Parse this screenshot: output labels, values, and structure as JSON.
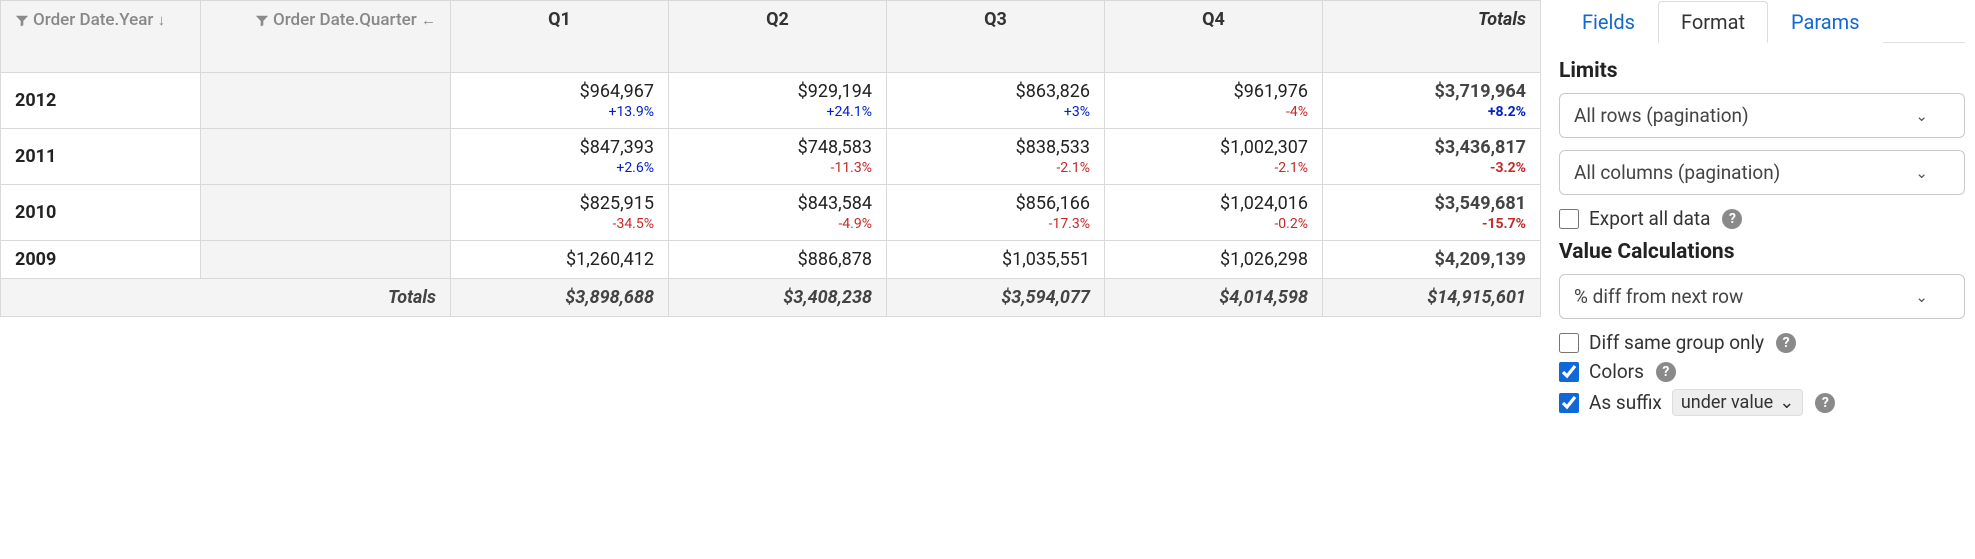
{
  "pivot": {
    "row_header": {
      "label": "Order Date.Year",
      "sort_indicator": "↓"
    },
    "col_header": {
      "label": "Order Date.Quarter",
      "sort_indicator": "←"
    },
    "columns": [
      "Q1",
      "Q2",
      "Q3",
      "Q4"
    ],
    "totals_label": "Totals",
    "rows": [
      {
        "year": "2012",
        "cells": [
          {
            "value": "$964,967",
            "pct": "+13.9%",
            "dir": "pos"
          },
          {
            "value": "$929,194",
            "pct": "+24.1%",
            "dir": "pos"
          },
          {
            "value": "$863,826",
            "pct": "+3%",
            "dir": "pos"
          },
          {
            "value": "$961,976",
            "pct": "-4%",
            "dir": "neg"
          }
        ],
        "total": {
          "value": "$3,719,964",
          "pct": "+8.2%",
          "dir": "pos"
        }
      },
      {
        "year": "2011",
        "cells": [
          {
            "value": "$847,393",
            "pct": "+2.6%",
            "dir": "pos"
          },
          {
            "value": "$748,583",
            "pct": "-11.3%",
            "dir": "neg"
          },
          {
            "value": "$838,533",
            "pct": "-2.1%",
            "dir": "neg"
          },
          {
            "value": "$1,002,307",
            "pct": "-2.1%",
            "dir": "neg"
          }
        ],
        "total": {
          "value": "$3,436,817",
          "pct": "-3.2%",
          "dir": "neg"
        }
      },
      {
        "year": "2010",
        "cells": [
          {
            "value": "$825,915",
            "pct": "-34.5%",
            "dir": "neg"
          },
          {
            "value": "$843,584",
            "pct": "-4.9%",
            "dir": "neg"
          },
          {
            "value": "$856,166",
            "pct": "-17.3%",
            "dir": "neg"
          },
          {
            "value": "$1,024,016",
            "pct": "-0.2%",
            "dir": "neg"
          }
        ],
        "total": {
          "value": "$3,549,681",
          "pct": "-15.7%",
          "dir": "neg"
        }
      },
      {
        "year": "2009",
        "cells": [
          {
            "value": "$1,260,412",
            "pct": "",
            "dir": ""
          },
          {
            "value": "$886,878",
            "pct": "",
            "dir": ""
          },
          {
            "value": "$1,035,551",
            "pct": "",
            "dir": ""
          },
          {
            "value": "$1,026,298",
            "pct": "",
            "dir": ""
          }
        ],
        "total": {
          "value": "$4,209,139",
          "pct": "",
          "dir": ""
        }
      }
    ],
    "grand_totals": [
      "$3,898,688",
      "$3,408,238",
      "$3,594,077",
      "$4,014,598",
      "$14,915,601"
    ]
  },
  "sidepanel": {
    "tabs": {
      "fields": "Fields",
      "format": "Format",
      "params": "Params",
      "active": "format"
    },
    "limits": {
      "title": "Limits",
      "rows_select": "All rows (pagination)",
      "cols_select": "All columns (pagination)",
      "export_label": "Export all data",
      "export_checked": false
    },
    "valuecalc": {
      "title": "Value Calculations",
      "calc_select": "% diff from next row",
      "diff_same_group_label": "Diff same group only",
      "diff_same_group_checked": false,
      "colors_label": "Colors",
      "colors_checked": true,
      "suffix_label": "As suffix",
      "suffix_checked": true,
      "suffix_select": "under value"
    }
  }
}
